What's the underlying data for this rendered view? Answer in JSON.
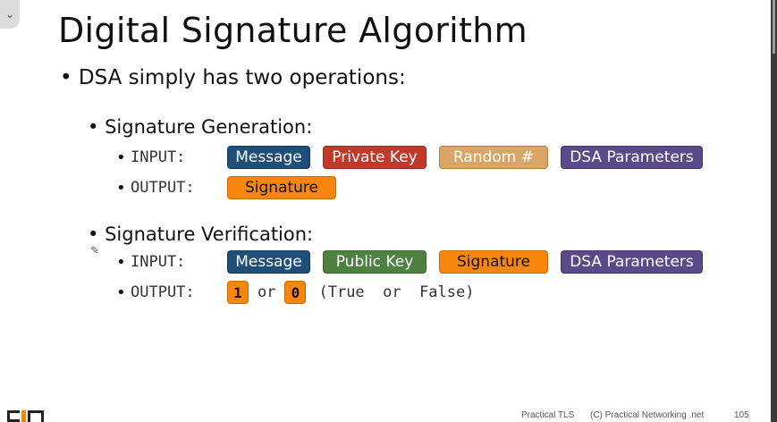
{
  "slide": {
    "title": "Digital Signature Algorithm",
    "main_bullet": "DSA simply has two operations:",
    "generation": {
      "heading": "Signature Generation:",
      "input_label": "INPUT:",
      "inputs": [
        "Message",
        "Private Key",
        "Random #",
        "DSA Parameters"
      ],
      "output_label": "OUTPUT:",
      "output": "Signature"
    },
    "verification": {
      "heading": "Signature Verification:",
      "input_label": "INPUT:",
      "inputs": [
        "Message",
        "Public Key",
        "Signature",
        "DSA Parameters"
      ],
      "output_label": "OUTPUT:",
      "output_one": "1",
      "output_or": "or",
      "output_zero": "0",
      "output_note": "(True  or  False)"
    },
    "bullet_glyph": "•",
    "colors": {
      "message": "#1f4e79",
      "private_key": "#c0392b",
      "random": "#d9a566",
      "dsa_parameters": "#5b4a8a",
      "signature": "#f7860f",
      "public_key": "#4e8140"
    }
  },
  "footer": {
    "course": "Practical TLS",
    "copyright": "(C) Practical Networking .net",
    "page_number": "105"
  },
  "ui": {
    "collapse_icon": "chevron-down-icon",
    "collapse_glyph": "⌄",
    "pencil_icon": "pencil-icon",
    "pencil_glyph": "✎"
  }
}
